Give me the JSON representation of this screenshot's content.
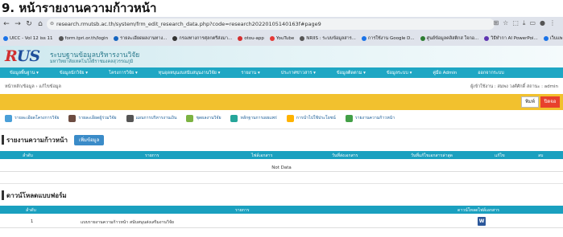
{
  "caption": "9. หน้ารายงานความก้าวหน้า",
  "browser": {
    "url": "research.rmutsb.ac.th/system/frm_edit_research_data.php?code=research20220105140163f#page9",
    "nav_icons": [
      "back-icon",
      "forward-icon",
      "reload-icon",
      "home-icon"
    ],
    "toolbar_icons": [
      "translate-icon",
      "bookmark-star-icon",
      "extensions-icon",
      "download-icon",
      "sidepanel-icon",
      "profile-icon",
      "menu-icon"
    ],
    "bookmarks": [
      {
        "label": "UICC - Vol 12 iss 11",
        "color": "#1a73e8"
      },
      {
        "label": "form.tpri.or.th/login",
        "color": "#555555"
      },
      {
        "label": "รายละเอียดผลงานทาง...",
        "color": "#1565c0"
      },
      {
        "label": "กรองทางการศุลกตรีส่งมา...",
        "color": "#333333"
      },
      {
        "label": "otou-app",
        "color": "#d32f2f"
      },
      {
        "label": "YouTube",
        "color": "#e53935"
      },
      {
        "label": "NRIIS : ระบบข้อมูลสาร...",
        "color": "#555555"
      },
      {
        "label": "การใช้งาน Google D...",
        "color": "#1a73e8"
      },
      {
        "label": "ศูนย์ข้อมูลคลิสติกส ใจกอ...",
        "color": "#2e7d32"
      },
      {
        "label": "วิธีทำกา AI PowerPoi...",
        "color": "#5e35b1"
      },
      {
        "label": "เว็บแพล",
        "color": "#1a73e8"
      }
    ]
  },
  "site": {
    "logo_main": "R",
    "logo_rest": "US",
    "title": "ระบบฐานข้อมูลบริหารงานวิจัย",
    "subtitle": "มหาวิทยาลัยเทคโนโลยีราชมงคลสุวรรณภูมิ"
  },
  "main_nav": [
    "ข้อมูลพื้นฐาน ▾",
    "ข้อมูลนักวิจัย ▾",
    "โครงการวิจัย ▾",
    "ทุนอุดหนุนงบสนับสนุนงานวิจัย ▾",
    "รายงาน ▾",
    "ประกาศข่าวสาร ▾",
    "ข้อมูลติดตาม ▾",
    "ข้อมูลระบบ ▾",
    "คู่มือ Admin",
    "ออกจากระบบ"
  ],
  "breadcrumb": "หน้าหลัก/ข้อมูล › แก้ไขข้อมูล",
  "user_info": "ผู้เข้าใช้งาน : สมพง วงศ์ศักดิ์   สถานะ : admin",
  "actions": {
    "print": "พิมพ์",
    "close": "ปิดจอ"
  },
  "sub_tabs": [
    {
      "label": "รายละเอียดโครงการวิจัย",
      "icon": "project-icon",
      "color": "#4a9fd8"
    },
    {
      "label": "รายละเอียดผู้ร่วมวิจัย",
      "icon": "researcher-icon",
      "color": "#6d4c41"
    },
    {
      "label": "แผนการบริหารงานเงิน",
      "icon": "budget-plan-icon",
      "color": "#555555"
    },
    {
      "label": "ชุดผลงานวิจัย",
      "icon": "output-icon",
      "color": "#7cb342"
    },
    {
      "label": "หลักฐานการเผยแพร่",
      "icon": "evidence-icon",
      "color": "#26a69a"
    },
    {
      "label": "การนำไปใช้ประโยชน์",
      "icon": "utilization-icon",
      "color": "#ffb300"
    },
    {
      "label": "รายงานความก้าวหน้า",
      "icon": "progress-report-icon",
      "color": "#43a047"
    }
  ],
  "progress_section": {
    "title": "รายงานความก้าวหน้า",
    "add_button": "เพิ่มข้อมูล",
    "columns": [
      "ลำดับ",
      "รายการ",
      "ไฟล์เอกสาร",
      "วันที่ส่งเอกสาร",
      "วันที่แก้ไขเอกสารล่าสุด",
      "แก้ไข",
      "ลบ"
    ],
    "empty_text": "Not Data"
  },
  "download_section": {
    "title": "ดาวน์โหลดแบบฟอร์ม",
    "columns": [
      "ลำดับ",
      "รายการ",
      "ดาวน์โหลดไฟล์เอกสาร"
    ],
    "rows": [
      {
        "no": "1",
        "item": "แบบรายงานความก้าวหน้า สนับสนุนส่งเสริมงานวิจัย",
        "file_icon": "word-file-icon"
      }
    ]
  }
}
